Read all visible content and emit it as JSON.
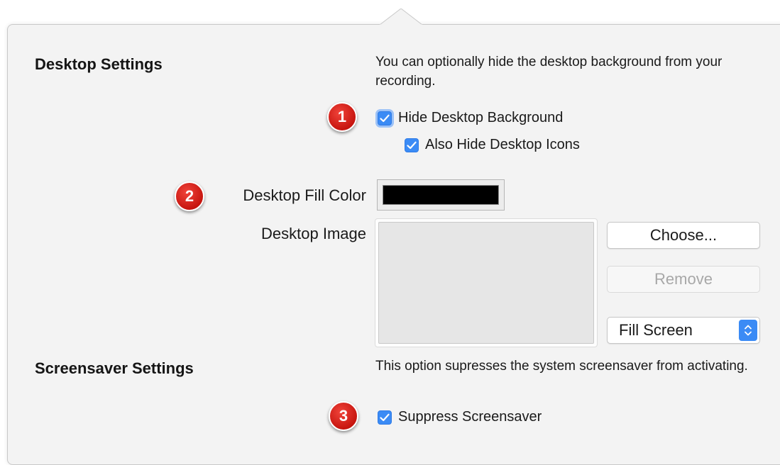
{
  "desktop_settings": {
    "title": "Desktop Settings",
    "description": "You can optionally hide the desktop background from your recording.",
    "hide_background_label": "Hide Desktop Background",
    "hide_background_checked": true,
    "hide_icons_label": "Also Hide Desktop Icons",
    "hide_icons_checked": true,
    "fill_color_label": "Desktop Fill Color",
    "fill_color_value": "#000000",
    "image_label": "Desktop Image",
    "choose_button": "Choose...",
    "remove_button": "Remove",
    "scaling_select_value": "Fill Screen"
  },
  "screensaver_settings": {
    "title": "Screensaver Settings",
    "description": "This option supresses the system screensaver from activating.",
    "suppress_label": "Suppress Screensaver",
    "suppress_checked": true
  },
  "badges": [
    "1",
    "2",
    "3"
  ],
  "colors": {
    "accent": "#3b8bf5",
    "badge": "#d9221b",
    "panel_bg": "#f3f3f3"
  }
}
